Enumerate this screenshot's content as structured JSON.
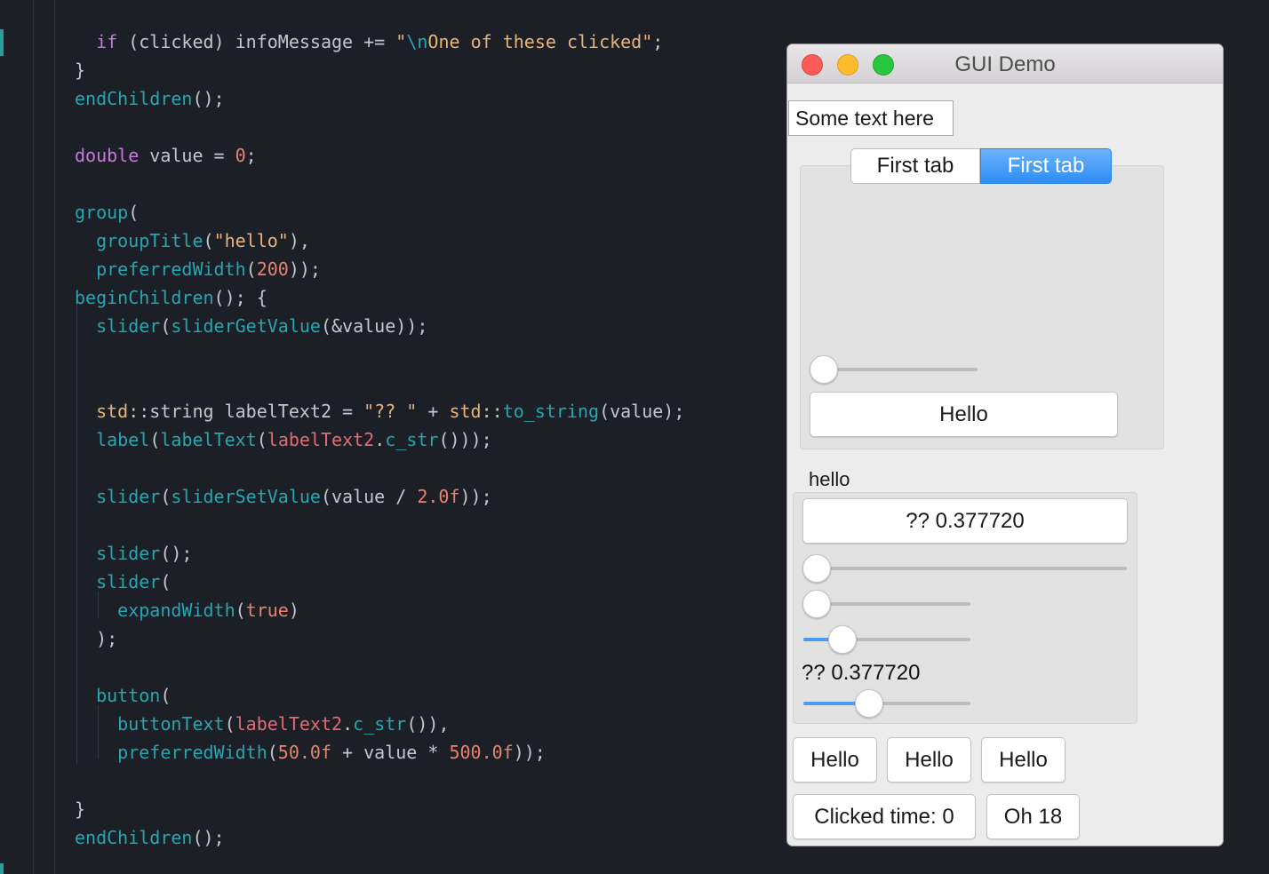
{
  "editor": {
    "lines": [
      [
        [
          "p",
          "  "
        ],
        [
          "k",
          "if"
        ],
        [
          "p",
          " (clicked) infoMessage += "
        ],
        [
          "s",
          "\""
        ],
        [
          "e",
          "\\n"
        ],
        [
          "s",
          "One of these clicked\""
        ],
        [
          "p",
          ";"
        ]
      ],
      [
        [
          "p",
          "}"
        ]
      ],
      [
        [
          "f",
          "endChildren"
        ],
        [
          "p",
          "();"
        ]
      ],
      [],
      [
        [
          "k",
          "double"
        ],
        [
          "p",
          " value = "
        ],
        [
          "n",
          "0"
        ],
        [
          "p",
          ";"
        ]
      ],
      [],
      [
        [
          "f",
          "group"
        ],
        [
          "p",
          "("
        ]
      ],
      [
        [
          "p",
          "  "
        ],
        [
          "f",
          "groupTitle"
        ],
        [
          "p",
          "("
        ],
        [
          "s",
          "\"hello\""
        ],
        [
          "p",
          "),"
        ]
      ],
      [
        [
          "p",
          "  "
        ],
        [
          "f",
          "preferredWidth"
        ],
        [
          "p",
          "("
        ],
        [
          "n",
          "200"
        ],
        [
          "p",
          "));"
        ]
      ],
      [
        [
          "f",
          "beginChildren"
        ],
        [
          "p",
          "(); {"
        ]
      ],
      [
        [
          "p",
          "  "
        ],
        [
          "f",
          "slider"
        ],
        [
          "p",
          "("
        ],
        [
          "f",
          "sliderGetValue"
        ],
        [
          "p",
          "(&value));"
        ]
      ],
      [],
      [],
      [
        [
          "p",
          "  "
        ],
        [
          "s",
          "std"
        ],
        [
          "p",
          "::string labelText2 = "
        ],
        [
          "s",
          "\"?? \""
        ],
        [
          "p",
          " + "
        ],
        [
          "s",
          "std"
        ],
        [
          "p",
          "::"
        ],
        [
          "f",
          "to_string"
        ],
        [
          "p",
          "(value);"
        ]
      ],
      [
        [
          "p",
          "  "
        ],
        [
          "f",
          "label"
        ],
        [
          "p",
          "("
        ],
        [
          "f",
          "labelText"
        ],
        [
          "p",
          "("
        ],
        [
          "v",
          "labelText2"
        ],
        [
          "p",
          "."
        ],
        [
          "f",
          "c_str"
        ],
        [
          "p",
          "()));"
        ]
      ],
      [],
      [
        [
          "p",
          "  "
        ],
        [
          "f",
          "slider"
        ],
        [
          "p",
          "("
        ],
        [
          "f",
          "sliderSetValue"
        ],
        [
          "p",
          "(value / "
        ],
        [
          "n",
          "2.0f"
        ],
        [
          "p",
          "));"
        ]
      ],
      [],
      [
        [
          "p",
          "  "
        ],
        [
          "f",
          "slider"
        ],
        [
          "p",
          "();"
        ]
      ],
      [
        [
          "p",
          "  "
        ],
        [
          "f",
          "slider"
        ],
        [
          "p",
          "("
        ]
      ],
      [
        [
          "p",
          "    "
        ],
        [
          "f",
          "expandWidth"
        ],
        [
          "p",
          "("
        ],
        [
          "n",
          "true"
        ],
        [
          "p",
          ")"
        ]
      ],
      [
        [
          "p",
          "  );"
        ]
      ],
      [],
      [
        [
          "p",
          "  "
        ],
        [
          "f",
          "button"
        ],
        [
          "p",
          "("
        ]
      ],
      [
        [
          "p",
          "    "
        ],
        [
          "f",
          "buttonText"
        ],
        [
          "p",
          "("
        ],
        [
          "v",
          "labelText2"
        ],
        [
          "p",
          "."
        ],
        [
          "f",
          "c_str"
        ],
        [
          "p",
          "()),"
        ]
      ],
      [
        [
          "p",
          "    "
        ],
        [
          "f",
          "preferredWidth"
        ],
        [
          "p",
          "("
        ],
        [
          "n",
          "50.0f"
        ],
        [
          "p",
          " + value * "
        ],
        [
          "n",
          "500.0f"
        ],
        [
          "p",
          "));"
        ]
      ],
      [],
      [
        [
          "p",
          "}"
        ]
      ],
      [
        [
          "f",
          "endChildren"
        ],
        [
          "p",
          "();"
        ]
      ]
    ]
  },
  "window": {
    "title": "GUI Demo",
    "text_field_value": "Some text here",
    "tabs": [
      {
        "label": "First tab",
        "selected": false
      },
      {
        "label": "First tab",
        "selected": true
      }
    ],
    "tab_content": {
      "slider_value": 0,
      "hello_button": "Hello"
    },
    "group": {
      "title": "hello",
      "label_button": "?? 0.377720",
      "slider_full_value": 0,
      "slider_2_value": 0,
      "slider_3_value": 0.18886,
      "label_text": "?? 0.377720",
      "slider_4_value": 0.37772
    },
    "buttons_row": [
      "Hello",
      "Hello",
      "Hello"
    ],
    "clicked_button": "Clicked time: 0",
    "oh_button": "Oh 18"
  },
  "colors": {
    "editor_bg": "#1c1f26",
    "keyword": "#c678dd",
    "function": "#26a6b0",
    "string": "#e8b47a",
    "number": "#e8836b",
    "variable": "#e06c75",
    "accent_blue": "#2d8cf5"
  }
}
